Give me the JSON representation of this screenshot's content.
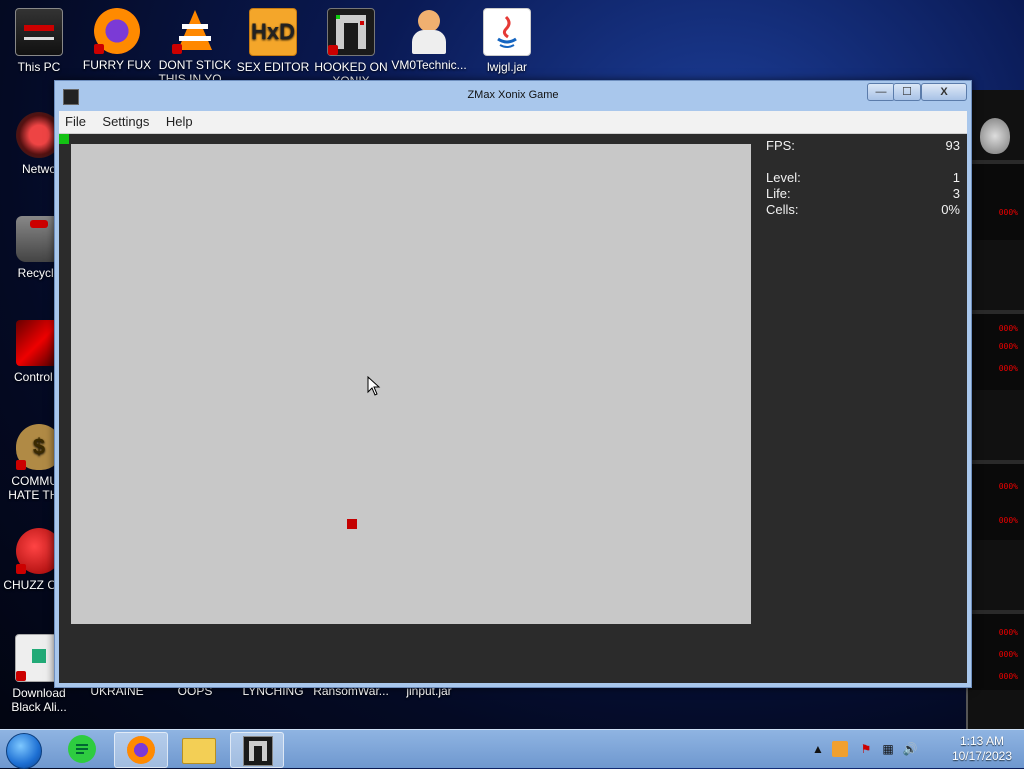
{
  "desktop": {
    "icons": [
      {
        "label": "This PC",
        "icon": "computer-icon"
      },
      {
        "label": "FURRY FUX",
        "icon": "firefox-icon"
      },
      {
        "label": "DONT STICK THIS IN YO...",
        "icon": "vlc-icon"
      },
      {
        "label": "SEX EDITOR",
        "icon": "hxd-icon"
      },
      {
        "label": "HOOKED ON XONIX",
        "icon": "xonix-icon"
      },
      {
        "label": "VM0Technic...",
        "icon": "doctor-icon"
      },
      {
        "label": "lwjgl.jar",
        "icon": "java-icon"
      }
    ],
    "left_icons": [
      {
        "label": "Netwo",
        "icon": "network-icon"
      },
      {
        "label": "Recycle",
        "icon": "recycle-bin-icon"
      },
      {
        "label": "Control P",
        "icon": "control-panel-icon"
      },
      {
        "label": "COMMUN HATE THIS",
        "icon": "money-bag-icon"
      },
      {
        "label": "CHUZZ CUM",
        "icon": "chuzzle-icon"
      },
      {
        "label": "Download Black Ali...",
        "icon": "download-icon"
      }
    ],
    "bottom_labels": [
      "UKRAINE",
      "OOPS",
      "LYNCHING",
      "RansomWar...",
      "jinput.jar"
    ],
    "panel_texts": [
      "000%",
      "000%",
      "000%",
      "000%",
      "000%",
      "000%",
      "000%",
      "000%",
      "000%",
      "000%"
    ]
  },
  "window": {
    "title": "ZMax Xonix Game",
    "controls": {
      "minimize": "—",
      "maximize": "☐",
      "close": "X"
    },
    "menu": [
      "File",
      "Settings",
      "Help"
    ]
  },
  "game": {
    "fps_label": "FPS:",
    "fps": "93",
    "level_label": "Level:",
    "level": "1",
    "life_label": "Life:",
    "life": "3",
    "cells_label": "Cells:",
    "cells": "0%",
    "colors": {
      "field": "#c8c8c8",
      "border": "#2b2b2b",
      "player": "#13c213",
      "enemy": "#c40000"
    }
  },
  "taskbar": {
    "apps": [
      "start-orb-icon",
      "notes-icon",
      "firefox-icon",
      "file-explorer-icon",
      "xonix-icon"
    ],
    "clock_time": "1:13 AM",
    "clock_date": "10/17/2023"
  }
}
